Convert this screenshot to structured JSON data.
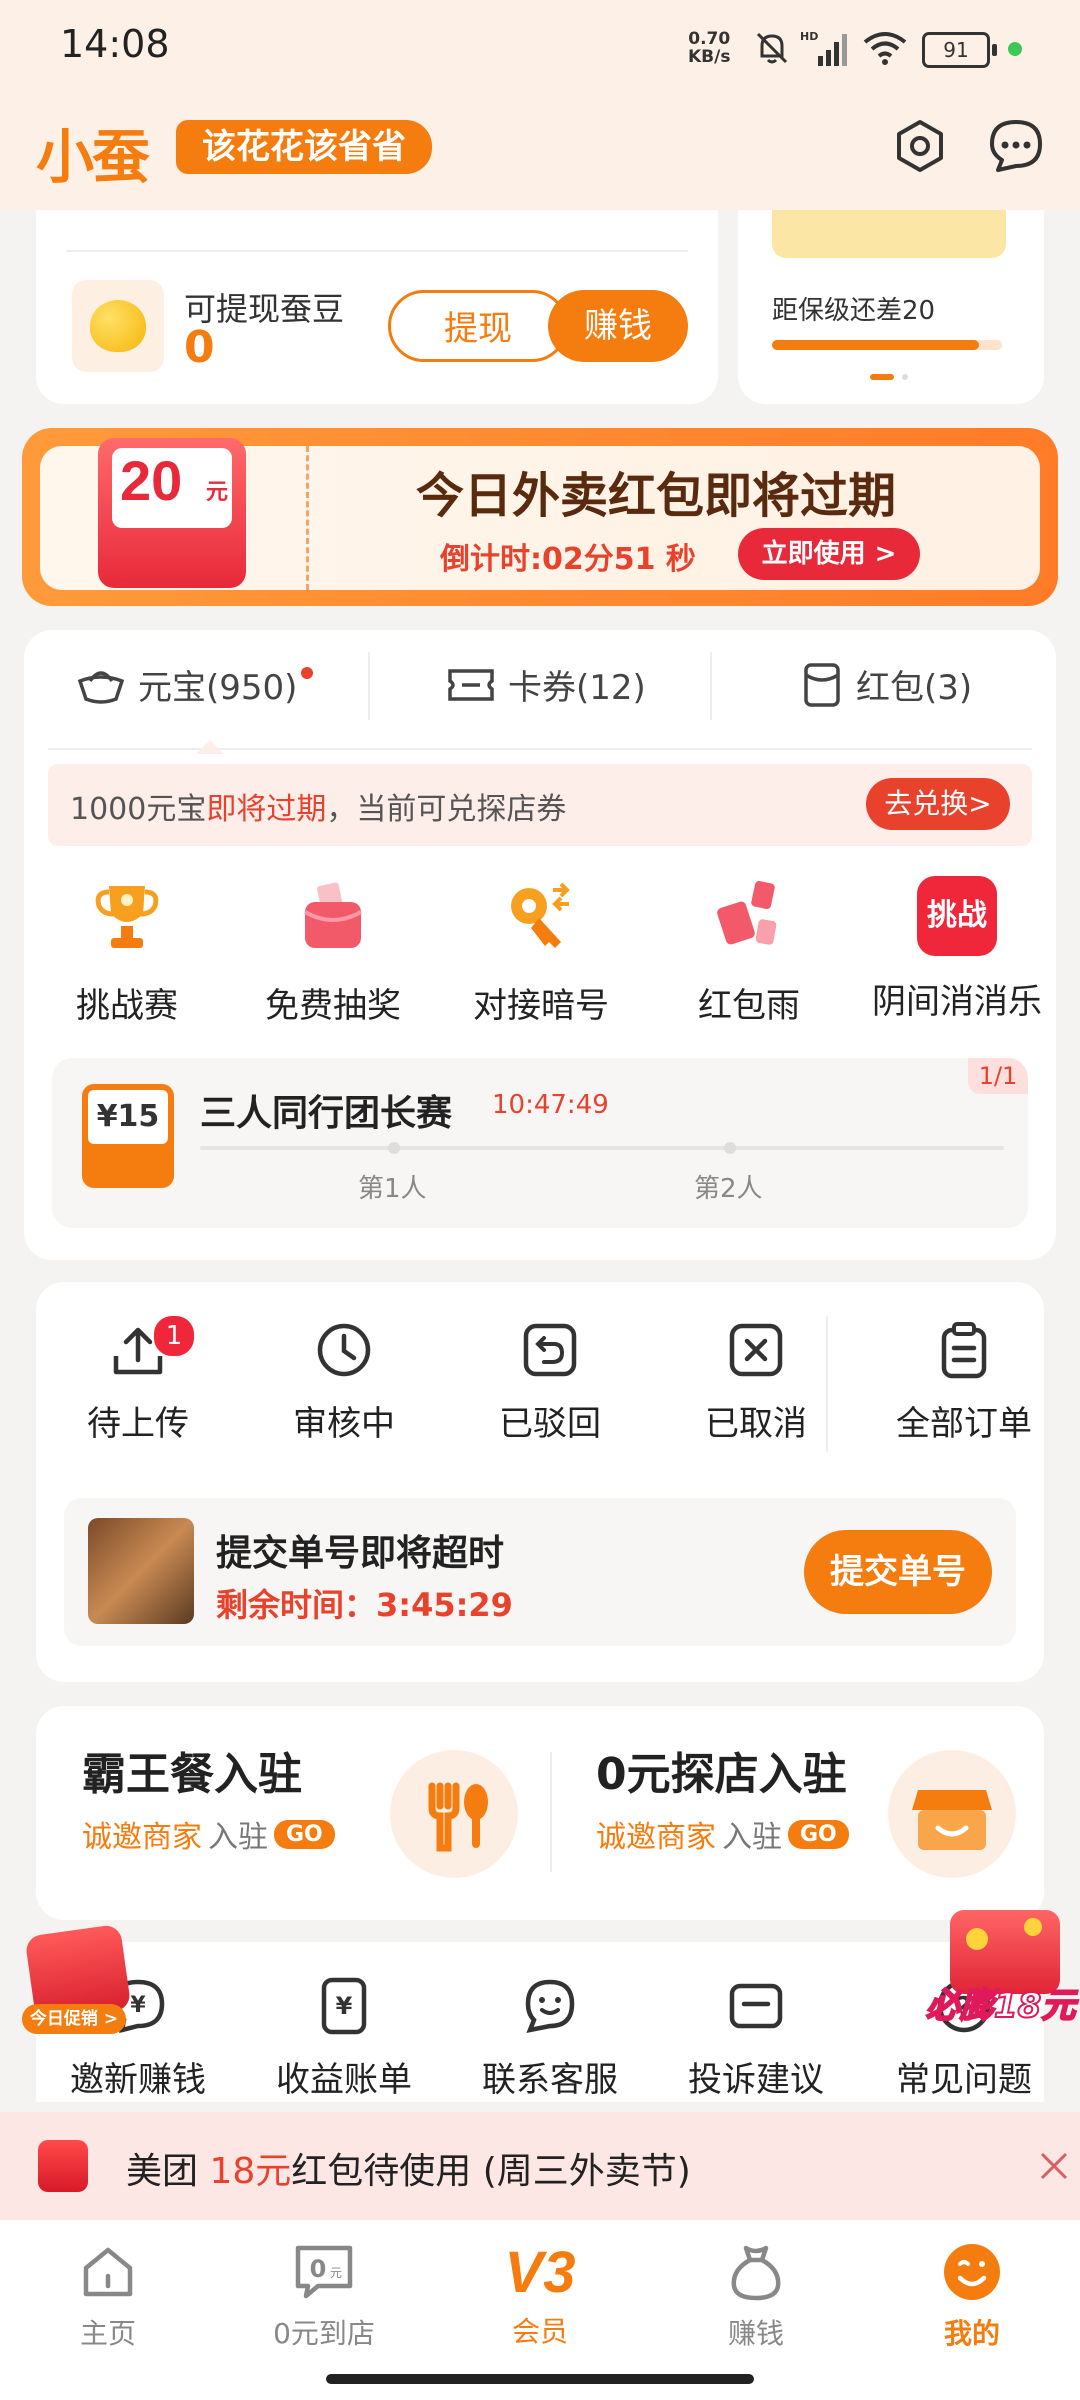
{
  "status": {
    "time": "14:08",
    "net_speed": "0.70",
    "net_unit": "KB/s",
    "battery": "91"
  },
  "app": {
    "logo": "小蚕",
    "slogan": "该花花该省省"
  },
  "balance": {
    "label": "可提现蚕豆",
    "value": "0",
    "withdraw": "提现",
    "earn": "赚钱"
  },
  "level": {
    "text": "距保级还差20",
    "progress": 0.9
  },
  "promo": {
    "amount": "20",
    "unit": "元",
    "title": "今日外卖红包即将过期",
    "countdown": "倒计时:02分51 秒",
    "button": "立即使用 >"
  },
  "tabs": [
    {
      "label": "元宝(950)",
      "icon": "ingot-icon"
    },
    {
      "label": "卡券(12)",
      "icon": "ticket-icon"
    },
    {
      "label": "红包(3)",
      "icon": "redpacket-icon"
    }
  ],
  "notice": {
    "prefix": "1000元宝",
    "highlight": "即将过期",
    "suffix": "，当前可兑探店券",
    "button": "去兑换>"
  },
  "quick": [
    {
      "label": "挑战赛",
      "icon": "trophy-icon"
    },
    {
      "label": "免费抽奖",
      "icon": "gift-box-icon"
    },
    {
      "label": "对接暗号",
      "icon": "key-icon"
    },
    {
      "label": "红包雨",
      "icon": "redpacket-rain-icon"
    },
    {
      "label": "阴间消消乐",
      "icon": "challenge-icon",
      "badge_text": "挑战"
    }
  ],
  "team": {
    "price": "¥15",
    "title": "三人同行团长赛",
    "time": "10:47:49",
    "page": "1/1",
    "step1": "第1人",
    "step2": "第2人"
  },
  "orders": [
    {
      "label": "待上传",
      "icon": "upload-icon",
      "badge": "1"
    },
    {
      "label": "审核中",
      "icon": "clock-icon"
    },
    {
      "label": "已驳回",
      "icon": "return-icon"
    },
    {
      "label": "已取消",
      "icon": "cancel-icon"
    },
    {
      "label": "全部订单",
      "icon": "clipboard-icon"
    }
  ],
  "pending": {
    "title": "提交单号即将超时",
    "remain_label": "剩余时间：",
    "remain": "3:45:29",
    "button": "提交单号"
  },
  "biz": [
    {
      "title": "霸王餐入驻",
      "sub_hl": "诚邀商家",
      "sub": "入驻",
      "go": "GO"
    },
    {
      "title": "0元探店入驻",
      "sub_hl": "诚邀商家",
      "sub": "入驻",
      "go": "GO"
    }
  ],
  "float_left": "今日促销 >",
  "float_right": "必膨18元",
  "tools": [
    {
      "label": "邀新赚钱",
      "icon": "invite-icon"
    },
    {
      "label": "收益账单",
      "icon": "bill-icon"
    },
    {
      "label": "联系客服",
      "icon": "service-icon"
    },
    {
      "label": "投诉建议",
      "icon": "complaint-icon"
    },
    {
      "label": "常见问题",
      "icon": "faq-icon"
    }
  ],
  "toast": {
    "prefix": "美团 ",
    "amount": "18元",
    "suffix": "红包待使用 (周三外卖节)"
  },
  "nav": [
    {
      "label": "主页",
      "icon": "home-icon"
    },
    {
      "label": "0元到店",
      "icon": "zero-store-icon"
    },
    {
      "label": "会员",
      "icon": "vip-icon",
      "badge": "V3"
    },
    {
      "label": "赚钱",
      "icon": "money-bag-icon"
    },
    {
      "label": "我的",
      "icon": "profile-icon"
    }
  ],
  "colors": {
    "accent": "#f57c0f",
    "red": "#e8412c",
    "bg": "#f4f3f1"
  }
}
